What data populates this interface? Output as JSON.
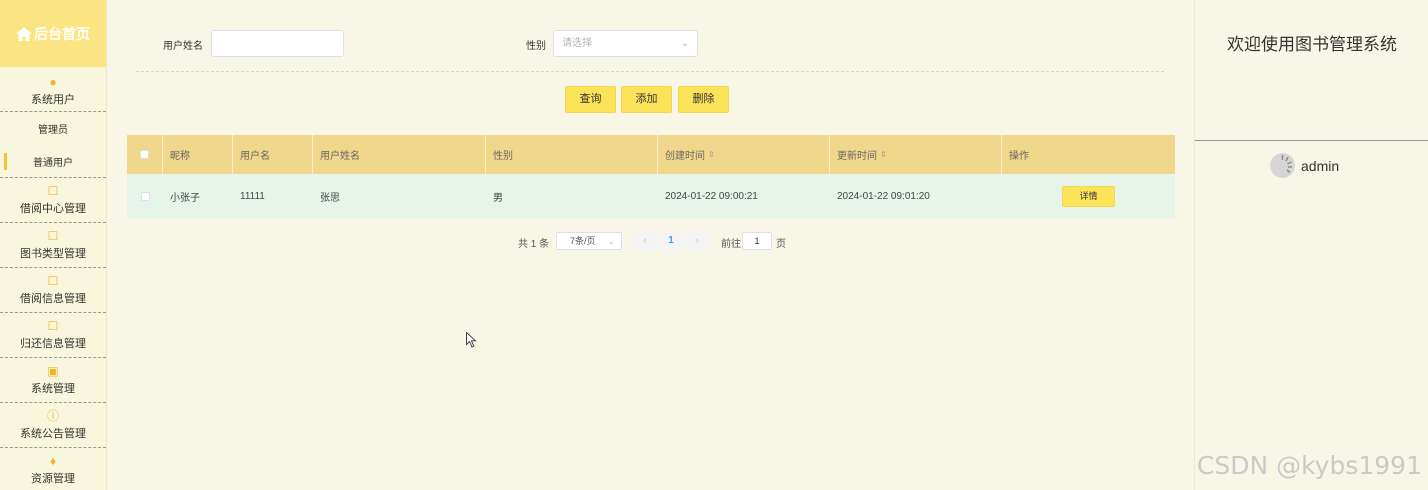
{
  "sidebar": {
    "brand": "后台首页",
    "groups": [
      {
        "label": "系统用户",
        "icon": "user-icon",
        "subs": [
          "管理员",
          "普通用户"
        ]
      },
      {
        "label": "借阅中心管理",
        "icon": "edit-icon"
      },
      {
        "label": "图书类型管理",
        "icon": "edit-icon"
      },
      {
        "label": "借阅信息管理",
        "icon": "edit-icon"
      },
      {
        "label": "归还信息管理",
        "icon": "edit-icon"
      },
      {
        "label": "系统管理",
        "icon": "image-icon"
      },
      {
        "label": "系统公告管理",
        "icon": "info-icon"
      },
      {
        "label": "资源管理",
        "icon": "location-icon"
      }
    ],
    "active_sub": "普通用户"
  },
  "search": {
    "name_label": "用户姓名",
    "name_value": "",
    "gender_label": "性别",
    "gender_placeholder": "请选择"
  },
  "buttons": {
    "query": "查询",
    "add": "添加",
    "delete": "删除"
  },
  "table": {
    "headers": [
      "昵称",
      "用户名",
      "用户姓名",
      "性别",
      "创建时间",
      "更新时间",
      "操作"
    ],
    "rows": [
      {
        "nickname": "小张子",
        "username": "11111",
        "realname": "张思",
        "gender": "男",
        "created": "2024-01-22 09:00:21",
        "updated": "2024-01-22 09:01:20",
        "action": "详情"
      }
    ]
  },
  "pagination": {
    "total": "共 1 条",
    "page_size": "7条/页",
    "current_page": "1",
    "goto_label": "前往",
    "goto_value": "1",
    "page_unit": "页"
  },
  "right": {
    "welcome": "欢迎使用图书管理系统",
    "username": "admin"
  },
  "watermark": "CSDN @kybs1991",
  "colors": {
    "brand": "#fbe583",
    "button": "#fbe35a",
    "table_header": "#f1d78b",
    "row_bg": "#e7f4ea",
    "page_bg": "#f8f7e7"
  }
}
